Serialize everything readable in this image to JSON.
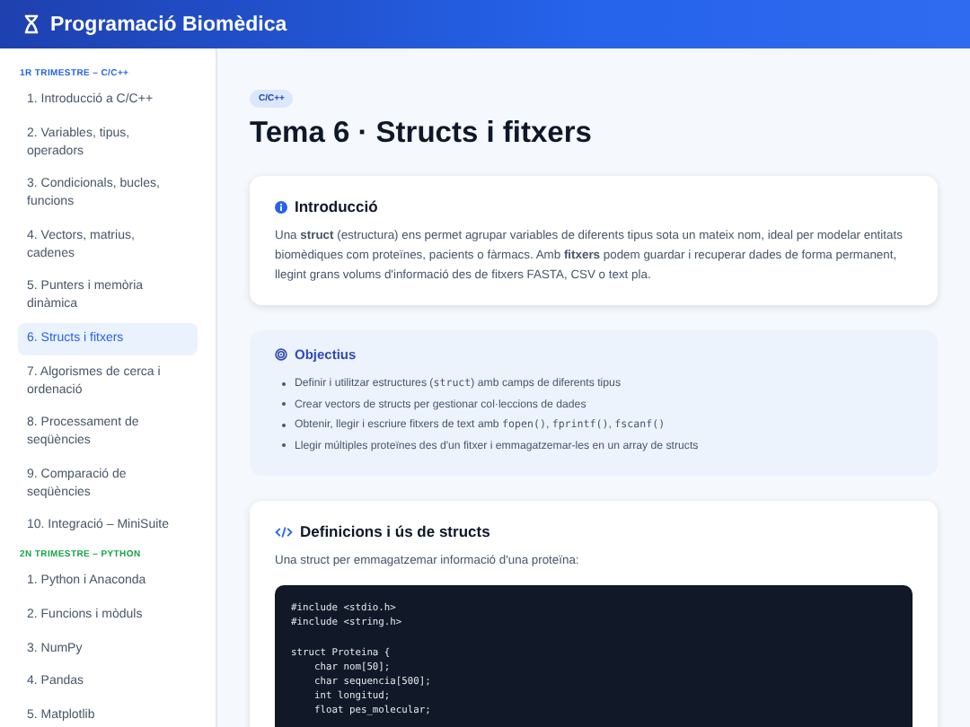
{
  "app": {
    "title": "Programació Biomèdica"
  },
  "sidebar": {
    "sections": [
      {
        "title": "1R TRIMESTRE – C/C++",
        "items": [
          {
            "label": "1. Introducció a C/C++",
            "selected": false
          },
          {
            "label": "2. Variables, tipus, operadors",
            "selected": false
          },
          {
            "label": "3. Condicionals, bucles, funcions",
            "selected": false
          },
          {
            "label": "4. Vectors, matrius, cadenes",
            "selected": false
          },
          {
            "label": "5. Punters i memòria dinàmica",
            "selected": false
          },
          {
            "label": "6. Structs i fitxers",
            "selected": true
          },
          {
            "label": "7. Algorismes de cerca i ordenació",
            "selected": false
          },
          {
            "label": "8. Processament de seqüències",
            "selected": false
          },
          {
            "label": "9. Comparació de seqüències",
            "selected": false
          },
          {
            "label": "10. Integració – MiniSuite",
            "selected": false
          }
        ]
      },
      {
        "title": "2N TRIMESTRE – PYTHON",
        "items": [
          {
            "label": "1. Python i Anaconda",
            "selected": false
          },
          {
            "label": "2. Funcions i mòduls",
            "selected": false
          },
          {
            "label": "3. NumPy",
            "selected": false
          },
          {
            "label": "4. Pandas",
            "selected": false
          },
          {
            "label": "5. Matplotlib",
            "selected": false
          }
        ]
      }
    ]
  },
  "page": {
    "tag": "C/C++",
    "title": "Tema 6 · Structs i fitxers",
    "sections": [
      {
        "kind": "info",
        "title": "Introducció",
        "text": "Una **struct** (estructura) ens permet agrupar variables de diferents tipus sota un mateix nom, ideal per modelar entitats biomèdiques com proteïnes, pacients o fàrmacs. Amb **fitxers** podem guardar i recuperar dades de forma permanent, llegint grans volums d'informació des de fitxers FASTA, CSV o text pla."
      },
      {
        "kind": "goals",
        "title": "Objectius",
        "items": [
          [
            {
              "kind": "text",
              "text": "Definir i utilitzar estructures ("
            },
            {
              "kind": "code",
              "text": "struct"
            },
            {
              "kind": "text",
              "text": ") amb camps de diferents tipus"
            }
          ],
          [
            {
              "kind": "text",
              "text": "Crear vectors de structs per gestionar col·leccions de dades"
            }
          ],
          [
            {
              "kind": "text",
              "text": "Obtenir, llegir i escriure fitxers de text amb "
            },
            {
              "kind": "code",
              "text": "fopen()"
            },
            {
              "kind": "text",
              "text": ", "
            },
            {
              "kind": "code",
              "text": "fprintf()"
            },
            {
              "kind": "text",
              "text": ", "
            },
            {
              "kind": "code",
              "text": "fscanf()"
            }
          ],
          [
            {
              "kind": "text",
              "text": "Llegir múltiples proteïnes des d'un fitxer i emmagatzemar-les en un array de structs"
            }
          ]
        ]
      },
      {
        "kind": "code",
        "title": "Definicions i ús de structs",
        "text": "Una struct per emmagatzemar informació d'una proteïna:",
        "code": [
          [
            "#include <stdio.h>",
            "#include <string.h>"
          ],
          [
            "struct Proteina {",
            "    char nom[50];",
            "    char sequencia[500];",
            "    int longitud;",
            "    float pes_molecular;"
          ]
        ]
      }
    ]
  }
}
